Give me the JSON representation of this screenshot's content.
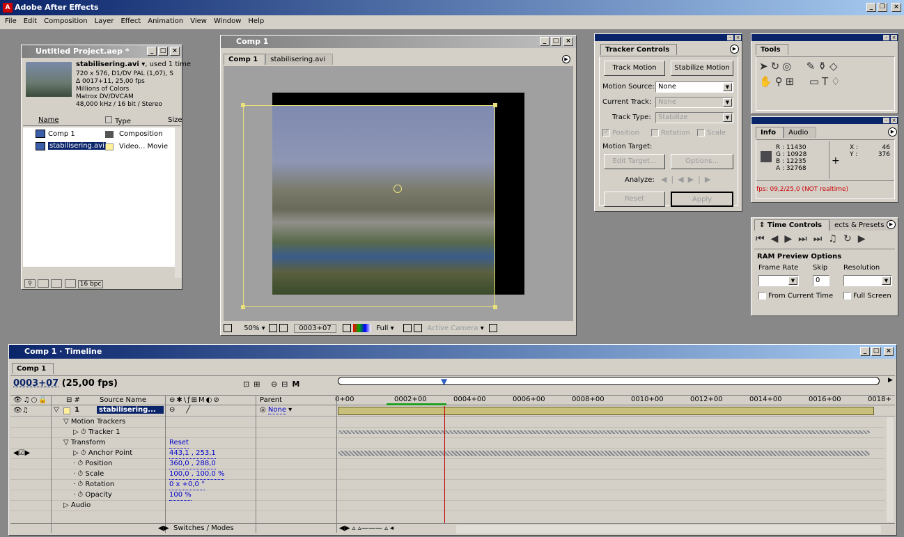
{
  "app": {
    "title": "Adobe After Effects"
  },
  "menu": [
    "File",
    "Edit",
    "Composition",
    "Layer",
    "Effect",
    "Animation",
    "View",
    "Window",
    "Help"
  ],
  "project": {
    "title": "Untitled Project.aep *",
    "file_name": "stabilisering.avi ▾",
    "used": ", used 1 time",
    "info": [
      "720 x 576, D1/DV PAL (1,07), S",
      "Δ 0017+11, 25,00 fps",
      "Millions of Colors",
      "Matrox DV/DVCAM",
      "48,000 kHz / 16 bit / Stereo"
    ],
    "columns": {
      "name": "Name",
      "type": "Type",
      "size": "Size"
    },
    "items": [
      {
        "name": "Comp 1",
        "type": "Composition"
      },
      {
        "name": "stabilisering.avi",
        "type": "Video... Movie"
      }
    ],
    "bpc": "16 bpc"
  },
  "comp": {
    "title": "Comp 1",
    "tabs": [
      "Comp 1",
      "stabilisering.avi"
    ],
    "zoom": "50%",
    "timecode": "0003+07",
    "resolution": "Full",
    "camera": "Active Camera"
  },
  "tracker": {
    "tab": "Tracker Controls",
    "track_motion": "Track Motion",
    "stabilize_motion": "Stabilize Motion",
    "motion_source_label": "Motion Source:",
    "motion_source": "None",
    "current_track_label": "Current Track:",
    "current_track": "None",
    "track_type_label": "Track Type:",
    "track_type": "Stabilize",
    "position": "Position",
    "rotation": "Rotation",
    "scale": "Scale",
    "motion_target": "Motion Target:",
    "edit_target": "Edit Target...",
    "options": "Options...",
    "analyze": "Analyze:",
    "reset": "Reset",
    "apply": "Apply"
  },
  "tools": {
    "tab": "Tools"
  },
  "info": {
    "tabs": [
      "Info",
      "Audio"
    ],
    "r": "R : 11430",
    "g": "G : 10928",
    "b": "B : 12235",
    "a": "A : 32768",
    "x_label": "X :",
    "x": "46",
    "y_label": "Y :",
    "y": "376",
    "fps": "fps: 09,2/25,0 (NOT realtime)",
    "swatch_color": "#4a4a4e"
  },
  "time_controls": {
    "tabs": [
      "Time Controls",
      "ects & Presets"
    ],
    "ram_title": "RAM Preview Options",
    "frame_rate": "Frame Rate",
    "skip": "Skip",
    "resolution": "Resolution",
    "skip_value": "0",
    "from_current": "From Current Time",
    "full_screen": "Full Screen"
  },
  "timeline": {
    "title": "Comp 1 · Timeline",
    "tab": "Comp 1",
    "timecode": "0003+07",
    "fps": "(25,00 fps)",
    "col_source": "Source Name",
    "col_parent": "Parent",
    "layer_num": "1",
    "layer_name": "stabilisering...",
    "parent": "None",
    "ticks": [
      "0+00",
      "0002+00",
      "0004+00",
      "0006+00",
      "0008+00",
      "0010+00",
      "0012+00",
      "0014+00",
      "0016+00",
      "0018+"
    ],
    "rows": [
      {
        "indent": 1,
        "label": "Motion Trackers",
        "twirl": "▽"
      },
      {
        "indent": 2,
        "label": "Tracker 1",
        "twirl": "▷"
      },
      {
        "indent": 1,
        "label": "Transform",
        "twirl": "▽",
        "value": "Reset"
      },
      {
        "indent": 2,
        "label": "Anchor Point",
        "twirl": "▷",
        "value": "443,1 , 253,1",
        "keyed": true
      },
      {
        "indent": 2,
        "label": "Position",
        "value": "360,0 , 288,0"
      },
      {
        "indent": 2,
        "label": "Scale",
        "value": "100,0 , 100,0 %"
      },
      {
        "indent": 2,
        "label": "Rotation",
        "value": "0 x +0,0 °"
      },
      {
        "indent": 2,
        "label": "Opacity",
        "value": "100 %"
      },
      {
        "indent": 1,
        "label": "Audio",
        "twirl": "▷"
      }
    ],
    "switches": "Switches / Modes"
  }
}
